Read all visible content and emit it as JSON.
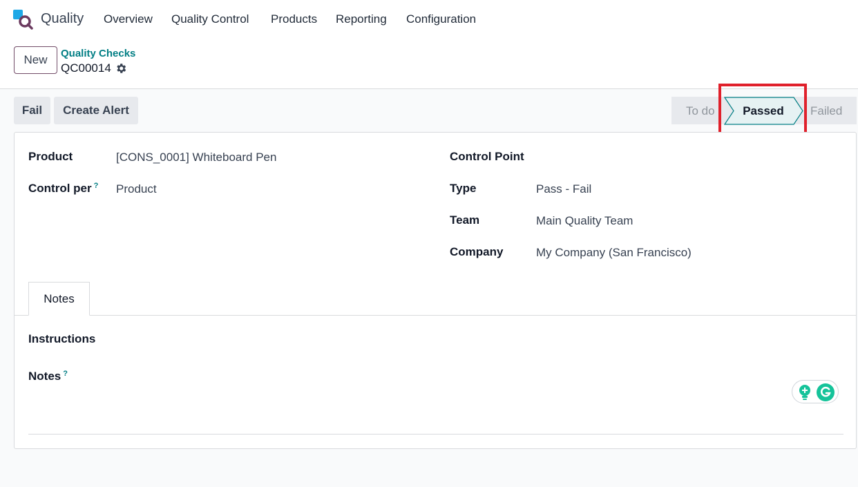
{
  "app": {
    "name": "Quality",
    "nav": [
      "Overview",
      "Quality Control",
      "Products",
      "Reporting",
      "Configuration"
    ]
  },
  "control_panel": {
    "new_label": "New",
    "breadcrumb": "Quality Checks",
    "record": "QC00014"
  },
  "actions": {
    "fail": "Fail",
    "create_alert": "Create Alert"
  },
  "statusbar": {
    "stages": [
      "To do",
      "Passed",
      "Failed"
    ],
    "current": "Passed"
  },
  "form": {
    "product_label": "Product",
    "product_value": "[CONS_0001] Whiteboard Pen",
    "control_per_label": "Control per",
    "control_per_value": "Product",
    "control_point_label": "Control Point",
    "type_label": "Type",
    "type_value": "Pass - Fail",
    "team_label": "Team",
    "team_value": "Main Quality Team",
    "company_label": "Company",
    "company_value": "My Company (San Francisco)",
    "help": "?"
  },
  "tabs": {
    "notes": "Notes"
  },
  "notes_tab": {
    "instructions_label": "Instructions",
    "notes_label": "Notes"
  },
  "colors": {
    "brand": "#714b67",
    "link": "#017e84",
    "highlight": "#e0202b"
  }
}
